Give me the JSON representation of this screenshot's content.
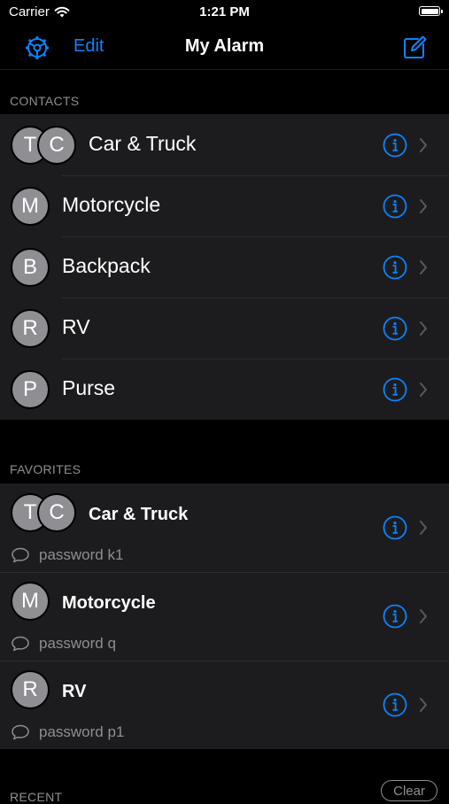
{
  "status_bar": {
    "carrier": "Carrier",
    "time": "1:21 PM"
  },
  "nav": {
    "edit_label": "Edit",
    "title": "My Alarm"
  },
  "contacts": {
    "header": "CONTACTS",
    "items": [
      {
        "label": "Car & Truck",
        "initials": [
          "T",
          "C"
        ]
      },
      {
        "label": "Motorcycle",
        "initials": [
          "M"
        ]
      },
      {
        "label": "Backpack",
        "initials": [
          "B"
        ]
      },
      {
        "label": "RV",
        "initials": [
          "R"
        ]
      },
      {
        "label": "Purse",
        "initials": [
          "P"
        ]
      }
    ]
  },
  "favorites": {
    "header": "FAVORITES",
    "items": [
      {
        "label": "Car & Truck",
        "initials": [
          "T",
          "C"
        ],
        "message": "password k1"
      },
      {
        "label": "Motorcycle",
        "initials": [
          "M"
        ],
        "message": "password q"
      },
      {
        "label": "RV",
        "initials": [
          "R"
        ],
        "message": "password p1"
      }
    ]
  },
  "recent": {
    "header": "RECENT",
    "clear_label": "Clear"
  },
  "colors": {
    "accent": "#0a84ff",
    "avatar": "#8e8e93",
    "row_background": "#1c1c1e",
    "secondary_text": "#8e8e93"
  }
}
